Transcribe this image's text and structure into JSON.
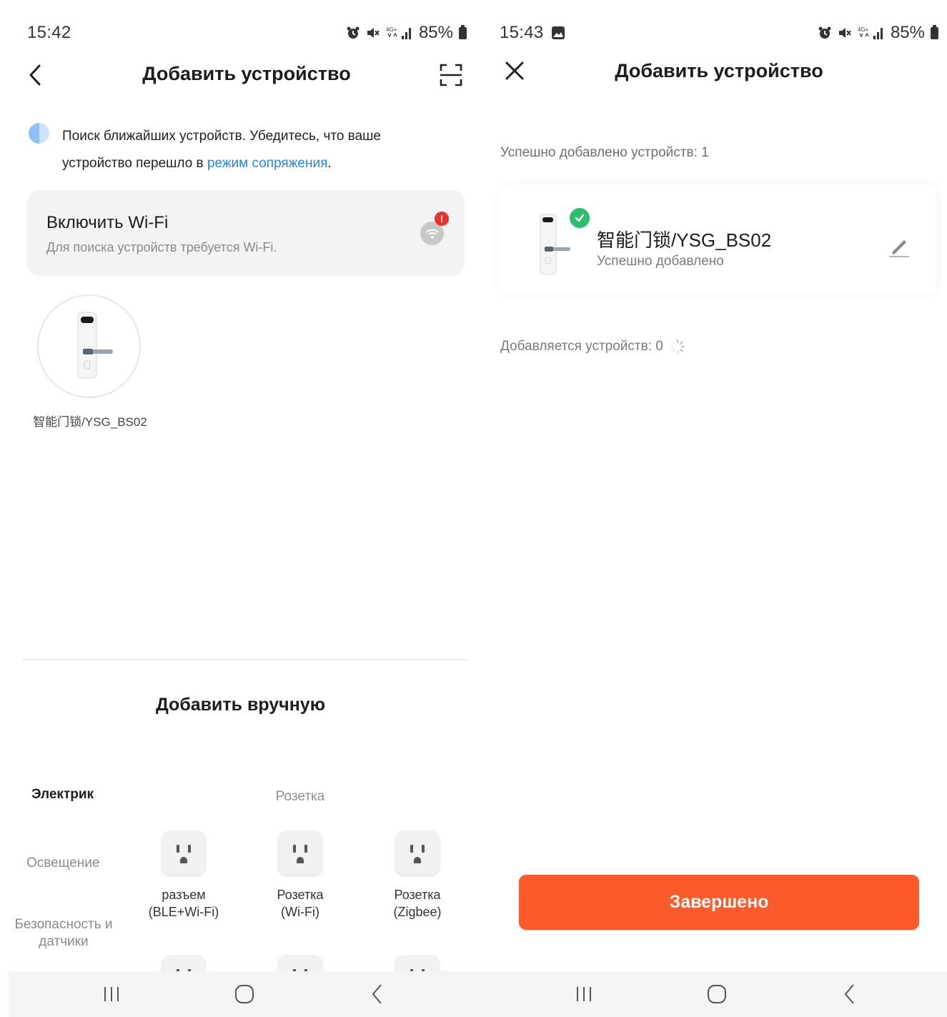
{
  "left": {
    "status": {
      "time": "15:42",
      "battery": "85%"
    },
    "header": {
      "title": "Добавить устройство"
    },
    "search": {
      "text_before": "Поиск ближайших устройств. Убедитесь, что ваше устройство перешло в ",
      "link": "режим сопряжения",
      "text_after": "."
    },
    "wifi_card": {
      "title": "Включить Wi-Fi",
      "subtitle": "Для поиска устройств требуется Wi-Fi.",
      "alert": "!"
    },
    "found_device": {
      "label": "智能门锁/YSG_BS02"
    },
    "manual": {
      "title": "Добавить вручную"
    },
    "categories": [
      {
        "label": "Электрик",
        "active": true
      },
      {
        "label": "Освещение",
        "active": false
      },
      {
        "label": "Безопасность и датчики",
        "active": false
      }
    ],
    "section": {
      "title": "Розетка"
    },
    "tiles": [
      {
        "line1": "разъем",
        "line2": "(BLE+Wi-Fi)"
      },
      {
        "line1": "Розетка",
        "line2": "(Wi-Fi)"
      },
      {
        "line1": "Розетка",
        "line2": "(Zigbee)"
      }
    ]
  },
  "right": {
    "status": {
      "time": "15:43",
      "battery": "85%"
    },
    "header": {
      "title": "Добавить устройство"
    },
    "success_count": "Успешно добавлено устройств: 1",
    "device": {
      "name": "智能门锁/YSG_BS02",
      "status": "Успешно добавлено"
    },
    "adding_count": "Добавляется устройств: 0",
    "done_button": "Завершено"
  },
  "colors": {
    "accent": "#fc5a2a",
    "link": "#2b86e3",
    "success": "#2dbd6e",
    "alert": "#e8322d"
  },
  "icons": [
    "back-icon",
    "scan-icon",
    "close-icon",
    "wifi-icon",
    "check-icon",
    "edit-icon",
    "recent-apps-icon",
    "home-icon",
    "nav-back-icon",
    "gallery-icon",
    "alarm-icon",
    "mute-icon",
    "signal-icon",
    "battery-icon",
    "loading-spinner-icon"
  ]
}
